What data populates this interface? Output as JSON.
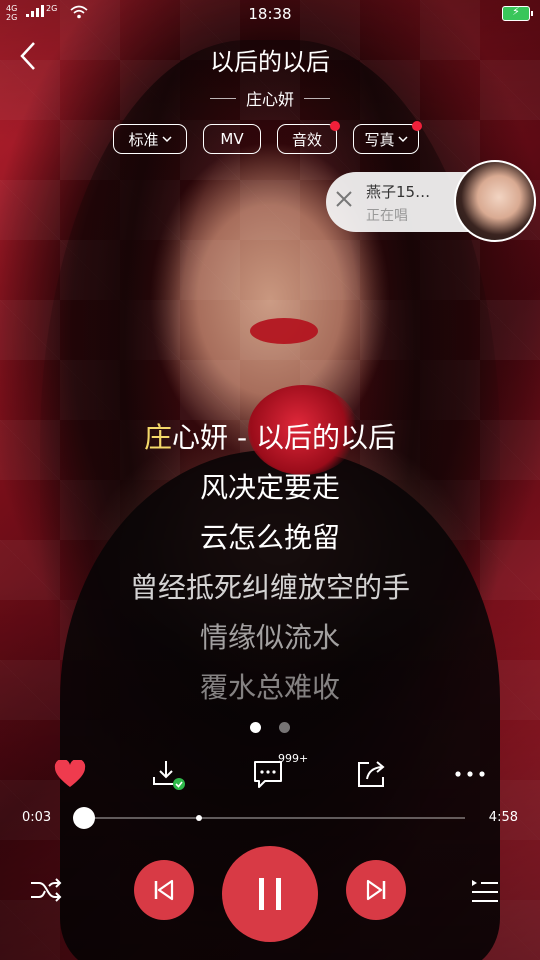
{
  "status_bar": {
    "time": "18:38",
    "network_1": "4G",
    "network_1b": "2G",
    "network_2": "2G",
    "battery_state": "charging"
  },
  "header": {
    "back_icon": "chevron-left-icon",
    "song_title": "以后的以后",
    "artist": "庄心妍"
  },
  "chips": [
    {
      "label": "标准",
      "has_dropdown": true,
      "has_dot": false
    },
    {
      "label": "MV",
      "has_dropdown": false,
      "has_dot": false
    },
    {
      "label": "音效",
      "has_dropdown": false,
      "has_dot": true
    },
    {
      "label": "写真",
      "has_dropdown": true,
      "has_dot": true
    }
  ],
  "singing_card": {
    "close_icon": "close-icon",
    "name": "燕子15…",
    "status": "正在唱"
  },
  "lyrics": {
    "line0_highlight": "庄",
    "line0_rest": "心妍 - 以后的以后",
    "lines": [
      "风决定要走",
      "云怎么挽留",
      "曾经抵死纠缠放空的手",
      "情缘似流水",
      "覆水总难收"
    ]
  },
  "pager": {
    "pages": 2,
    "active": 0
  },
  "actions": {
    "like_icon": "heart-icon",
    "download_icon": "download-icon",
    "comment_icon": "comment-icon",
    "comment_count": "999+",
    "share_icon": "share-icon",
    "more_icon": "more-icon"
  },
  "playback": {
    "current_time": "0:03",
    "total_time": "4:58",
    "progress": 0.01,
    "buffered": 0.31
  },
  "controls": {
    "shuffle_icon": "shuffle-icon",
    "prev_icon": "previous-icon",
    "play_state": "playing",
    "pause_icon": "pause-icon",
    "next_icon": "next-icon",
    "playlist_icon": "playlist-icon"
  },
  "colors": {
    "accent": "#d83a45",
    "lyric_highlight": "#f4d96a",
    "like": "#ef3b4e",
    "badge_dot": "#f0203a"
  }
}
